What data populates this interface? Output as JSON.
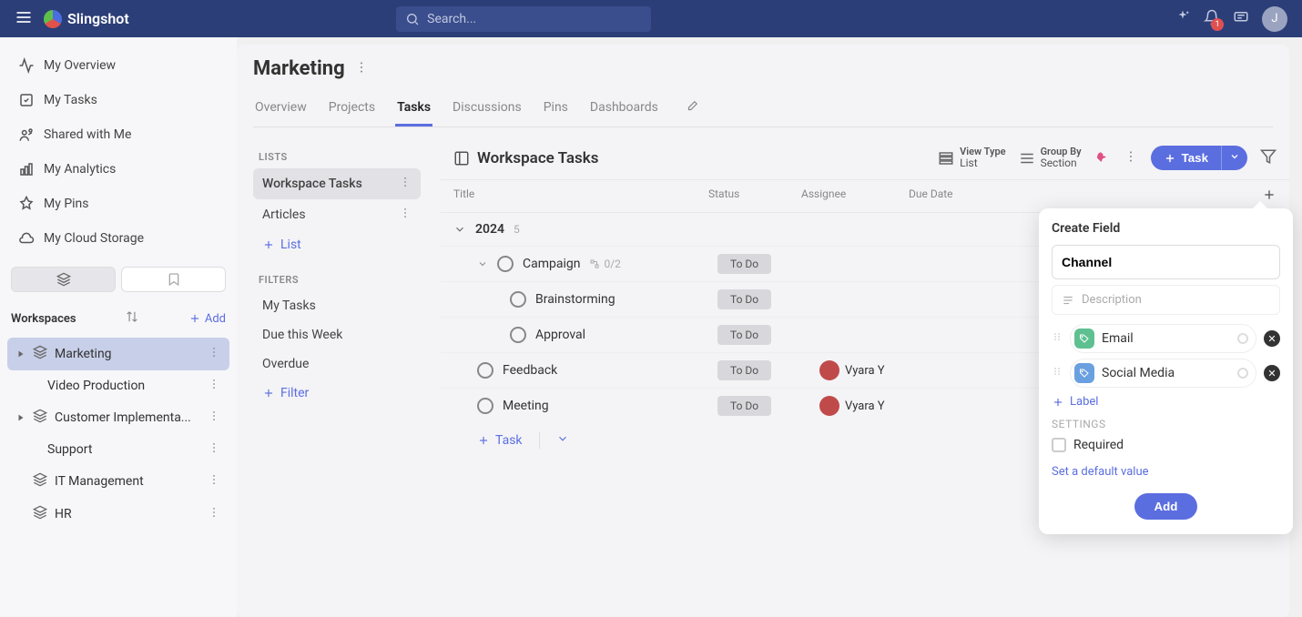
{
  "header": {
    "brand": "Slingshot",
    "search_placeholder": "Search...",
    "notification_count": "1",
    "avatar_initial": "J"
  },
  "nav": {
    "items": [
      {
        "label": "My Overview",
        "icon": "activity"
      },
      {
        "label": "My Tasks",
        "icon": "tasks"
      },
      {
        "label": "Shared with Me",
        "icon": "share"
      },
      {
        "label": "My Analytics",
        "icon": "chart"
      },
      {
        "label": "My Pins",
        "icon": "pin"
      },
      {
        "label": "My Cloud Storage",
        "icon": "cloud"
      }
    ],
    "workspaces_label": "Workspaces",
    "add_label": "Add",
    "workspaces": [
      {
        "label": "Marketing",
        "selected": true,
        "children": [
          "Video Production"
        ]
      },
      {
        "label": "Customer Implementa...",
        "children": [
          "Support"
        ]
      },
      {
        "label": "IT Management"
      },
      {
        "label": "HR"
      }
    ]
  },
  "page": {
    "title": "Marketing",
    "tabs": [
      "Overview",
      "Projects",
      "Tasks",
      "Discussions",
      "Pins",
      "Dashboards"
    ],
    "active_tab": "Tasks"
  },
  "lists_panel": {
    "lists_label": "LISTS",
    "lists": [
      "Workspace Tasks",
      "Articles"
    ],
    "selected": "Workspace Tasks",
    "add_list_label": "List",
    "filters_label": "FILTERS",
    "filters": [
      "My Tasks",
      "Due this Week",
      "Overdue"
    ],
    "add_filter_label": "Filter"
  },
  "tasks": {
    "title": "Workspace Tasks",
    "view_type_label": "View Type",
    "view_type_value": "List",
    "group_by_label": "Group By",
    "group_by_value": "Section",
    "new_task_label": "Task",
    "columns": {
      "title": "Title",
      "status": "Status",
      "assignee": "Assignee",
      "due_date": "Due Date"
    },
    "section": {
      "name": "2024",
      "count": "5"
    },
    "rows": [
      {
        "title": "Campaign",
        "status": "To Do",
        "sub": "0/2",
        "has_children": true,
        "indent": 1
      },
      {
        "title": "Brainstorming",
        "status": "To Do",
        "indent": 2
      },
      {
        "title": "Approval",
        "status": "To Do",
        "indent": 2
      },
      {
        "title": "Feedback",
        "status": "To Do",
        "assignee": "Vyara Y",
        "indent": 1
      },
      {
        "title": "Meeting",
        "status": "To Do",
        "assignee": "Vyara Y",
        "indent": 1
      }
    ],
    "add_task_label": "Task"
  },
  "create_field": {
    "heading": "Create Field",
    "name_value": "Channel",
    "description_placeholder": "Description",
    "options": [
      {
        "label": "Email",
        "swatch": "green"
      },
      {
        "label": "Social Media",
        "swatch": "blue"
      }
    ],
    "add_label": "Label",
    "settings_label": "SETTINGS",
    "required_label": "Required",
    "default_link": "Set a default value",
    "submit_label": "Add"
  }
}
